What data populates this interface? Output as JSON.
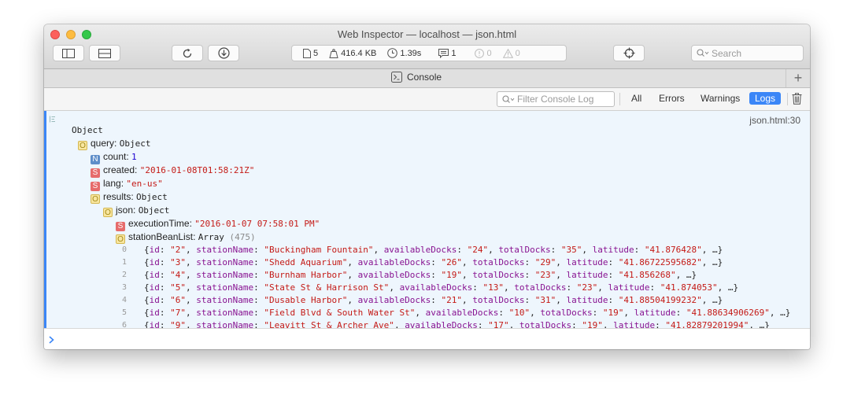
{
  "window": {
    "title": "Web Inspector — localhost — json.html"
  },
  "toolbar": {
    "stats": {
      "resources": "5",
      "size": "416.4 KB",
      "time": "1.39s",
      "logs": "1",
      "errors": "0",
      "warnings": "0"
    },
    "search_placeholder": "Search"
  },
  "tab": {
    "label": "Console"
  },
  "filter": {
    "placeholder": "Filter Console Log",
    "buttons": [
      "All",
      "Errors",
      "Warnings",
      "Logs"
    ],
    "active": "Logs"
  },
  "console": {
    "source": "json.html:30",
    "root": "Object",
    "query_key": "query",
    "query_type": "Object",
    "count_key": "count",
    "count_val": "1",
    "created_key": "created",
    "created_val": "\"2016-01-08T01:58:21Z\"",
    "lang_key": "lang",
    "lang_val": "\"en-us\"",
    "results_key": "results",
    "results_type": "Object",
    "json_key": "json",
    "json_type": "Object",
    "exec_key": "executionTime",
    "exec_val": "\"2016-01-07 07:58:01 PM\"",
    "sbl_key": "stationBeanList",
    "sbl_type": "Array",
    "sbl_len": "(475)",
    "stations": [
      {
        "index": "0",
        "id": "\"2\"",
        "stationName": "\"Buckingham Fountain\"",
        "availableDocks": "\"24\"",
        "totalDocks": "\"35\"",
        "latitude": "\"41.876428\""
      },
      {
        "index": "1",
        "id": "\"3\"",
        "stationName": "\"Shedd Aquarium\"",
        "availableDocks": "\"26\"",
        "totalDocks": "\"29\"",
        "latitude": "\"41.86722595682\""
      },
      {
        "index": "2",
        "id": "\"4\"",
        "stationName": "\"Burnham Harbor\"",
        "availableDocks": "\"19\"",
        "totalDocks": "\"23\"",
        "latitude": "\"41.856268\""
      },
      {
        "index": "3",
        "id": "\"5\"",
        "stationName": "\"State St & Harrison St\"",
        "availableDocks": "\"13\"",
        "totalDocks": "\"23\"",
        "latitude": "\"41.874053\""
      },
      {
        "index": "4",
        "id": "\"6\"",
        "stationName": "\"Dusable Harbor\"",
        "availableDocks": "\"21\"",
        "totalDocks": "\"31\"",
        "latitude": "\"41.88504199232\""
      },
      {
        "index": "5",
        "id": "\"7\"",
        "stationName": "\"Field Blvd & South Water St\"",
        "availableDocks": "\"10\"",
        "totalDocks": "\"19\"",
        "latitude": "\"41.88634906269\""
      },
      {
        "index": "6",
        "id": "\"9\"",
        "stationName": "\"Leavitt St & Archer Ave\"",
        "availableDocks": "\"17\"",
        "totalDocks": "\"19\"",
        "latitude": "\"41.82879201994\""
      }
    ]
  }
}
